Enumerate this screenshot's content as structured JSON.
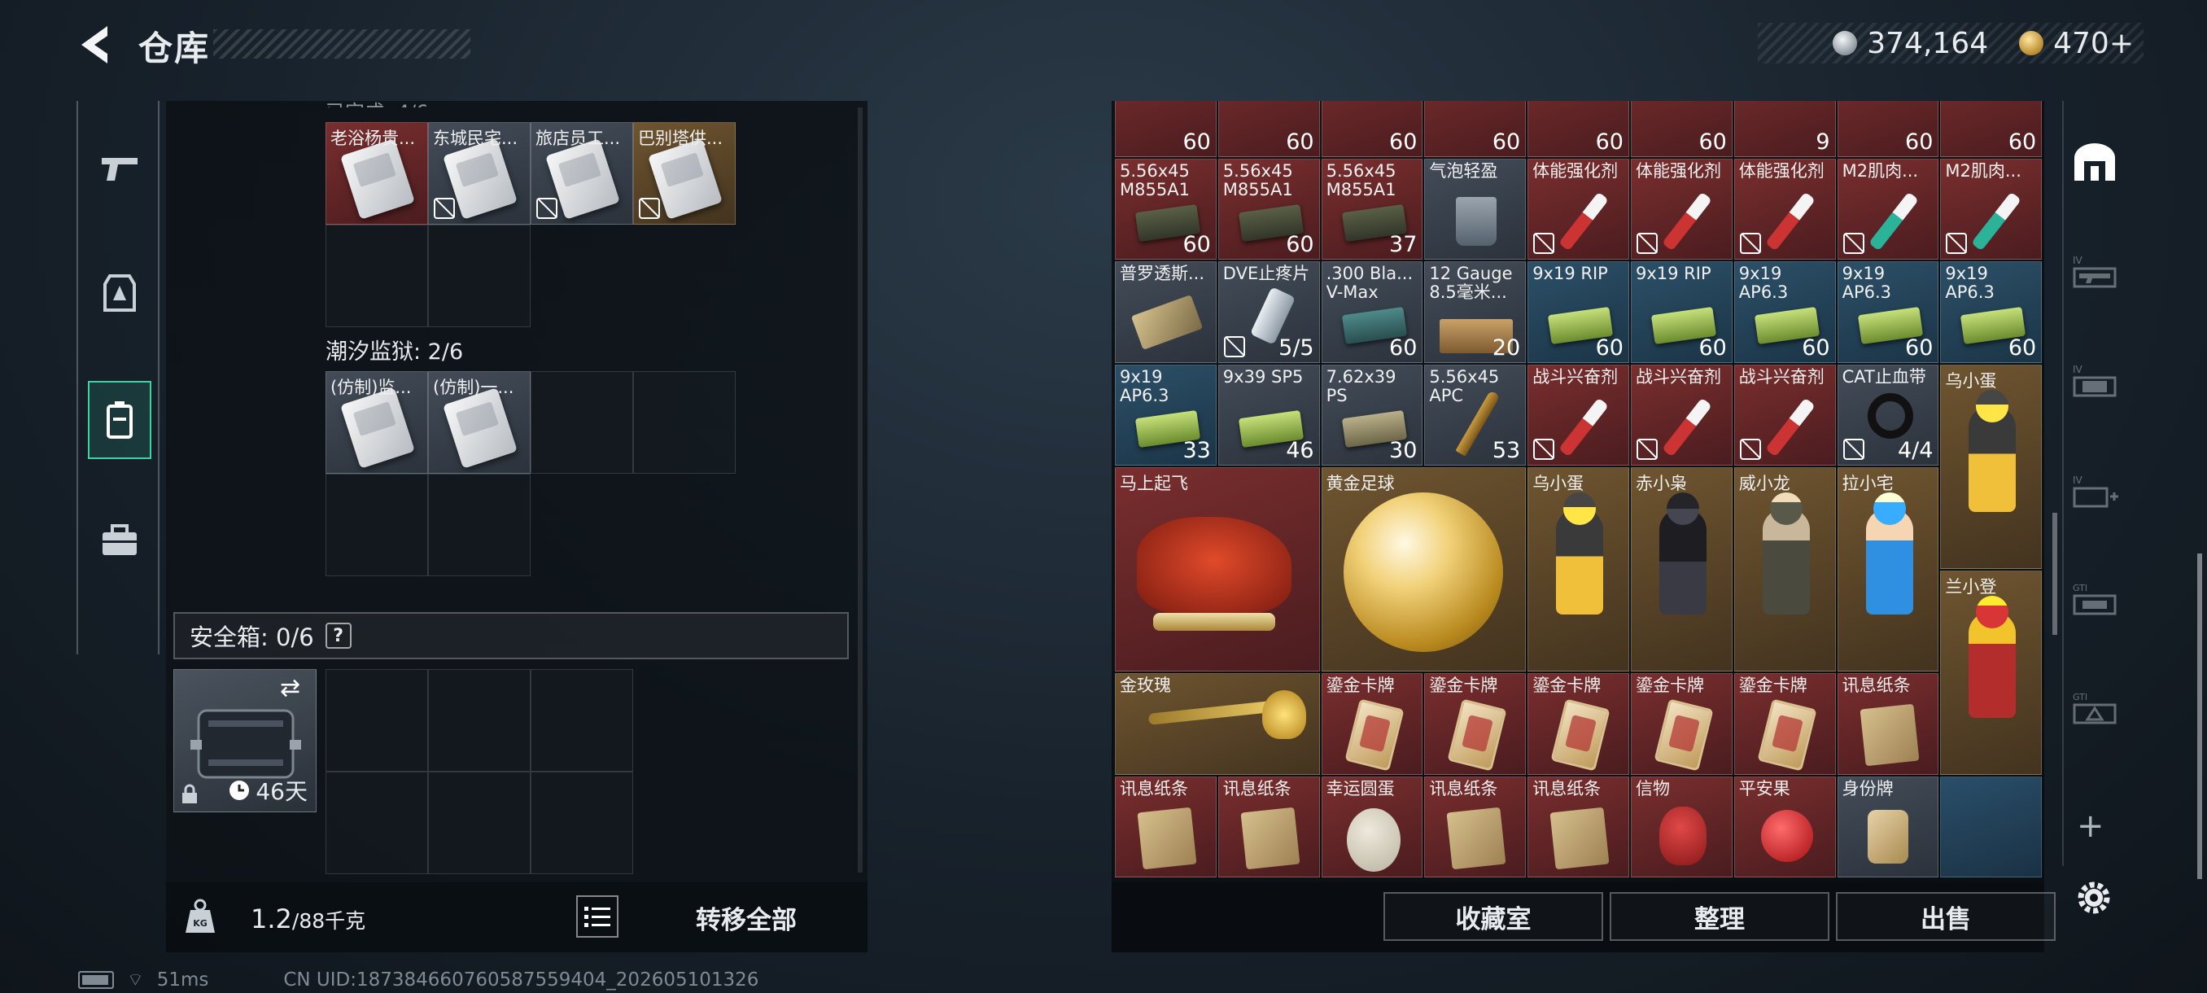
{
  "header": {
    "title": "仓库",
    "currency_silver": "374,164",
    "currency_gold": "470+"
  },
  "left_sections": {
    "section1_items": [
      {
        "label": "老浴杨贵...",
        "bg": "red",
        "noshare": false
      },
      {
        "label": "东城民宅...",
        "bg": "gray",
        "noshare": true
      },
      {
        "label": "旅店员工...",
        "bg": "gray",
        "noshare": true
      },
      {
        "label": "巴别塔供...",
        "bg": "gold",
        "noshare": true
      }
    ],
    "section2_label": "潮汐监狱: 2/6",
    "section2_items": [
      {
        "label": "(仿制)监...",
        "bg": "gray"
      },
      {
        "label": "(仿制)一...",
        "bg": "gray"
      }
    ],
    "safebox_label": "安全箱: 0/6",
    "safebox_help": "?",
    "safebox_days": "46天",
    "weight_value": "1.2",
    "weight_max": "/88千克",
    "transfer_label": "转移全部"
  },
  "status": {
    "ping": "51ms",
    "uid": "CN UID:18738466076058755940​4_202605101326"
  },
  "grid": {
    "row0": [
      "60",
      "60",
      "60",
      "60",
      "60",
      "60",
      "9",
      "60",
      "60"
    ],
    "items": [
      {
        "label": "5.56x45 M855A1",
        "qty": "60",
        "bg": "red",
        "art": "ammo",
        "col": 0,
        "row": 1
      },
      {
        "label": "5.56x45 M855A1",
        "qty": "60",
        "bg": "red",
        "art": "ammo",
        "col": 1,
        "row": 1
      },
      {
        "label": "5.56x45 M855A1",
        "qty": "37",
        "bg": "red",
        "art": "ammo",
        "col": 2,
        "row": 1
      },
      {
        "label": "气泡轻盈",
        "qty": "",
        "bg": "gray",
        "art": "glass",
        "col": 3,
        "row": 1
      },
      {
        "label": "体能强化剂",
        "qty": "",
        "bg": "red",
        "art": "syringe-red",
        "col": 4,
        "row": 1,
        "noshare": true
      },
      {
        "label": "体能强化剂",
        "qty": "",
        "bg": "red",
        "art": "syringe-red",
        "col": 5,
        "row": 1,
        "noshare": true
      },
      {
        "label": "体能强化剂",
        "qty": "",
        "bg": "red",
        "art": "syringe-red",
        "col": 6,
        "row": 1,
        "noshare": true
      },
      {
        "label": "M2肌肉...",
        "qty": "",
        "bg": "red",
        "art": "syringe-teal",
        "col": 7,
        "row": 1,
        "noshare": true
      },
      {
        "label": "M2肌肉...",
        "qty": "",
        "bg": "red",
        "art": "syringe-teal",
        "col": 8,
        "row": 1,
        "noshare": true
      },
      {
        "label": "普罗透斯...",
        "qty": "",
        "bg": "gray",
        "art": "chip",
        "col": 0,
        "row": 2
      },
      {
        "label": "DVE止疼片",
        "qty": "5/5",
        "bg": "gray",
        "art": "pill",
        "col": 1,
        "row": 2,
        "noshare": true
      },
      {
        "label": ".300 Bla... V-Max",
        "qty": "60",
        "bg": "gray",
        "art": "ammo-teal",
        "col": 2,
        "row": 2
      },
      {
        "label": "12 Gauge 8.5毫米...",
        "qty": "20",
        "bg": "gray",
        "art": "case",
        "col": 3,
        "row": 2
      },
      {
        "label": "9x19 RIP",
        "qty": "60",
        "bg": "blue",
        "art": "ammo-green",
        "col": 4,
        "row": 2
      },
      {
        "label": "9x19 RIP",
        "qty": "60",
        "bg": "blue",
        "art": "ammo-green",
        "col": 5,
        "row": 2
      },
      {
        "label": "9x19 AP6.3",
        "qty": "60",
        "bg": "blue",
        "art": "ammo-green",
        "col": 6,
        "row": 2
      },
      {
        "label": "9x19 AP6.3",
        "qty": "60",
        "bg": "blue",
        "art": "ammo-green",
        "col": 7,
        "row": 2
      },
      {
        "label": "9x19 AP6.3",
        "qty": "60",
        "bg": "blue",
        "art": "ammo-green",
        "col": 8,
        "row": 2
      },
      {
        "label": "9x19 AP6.3",
        "qty": "33",
        "bg": "blue",
        "art": "ammo-green",
        "col": 0,
        "row": 3
      },
      {
        "label": "9x39 SP5",
        "qty": "46",
        "bg": "gray",
        "art": "ammo-green",
        "col": 1,
        "row": 3
      },
      {
        "label": "7.62x39 PS",
        "qty": "30",
        "bg": "gray",
        "art": "ammo-tan",
        "col": 2,
        "row": 3
      },
      {
        "label": "5.56x45 APC",
        "qty": "53",
        "bg": "gray",
        "art": "bullet",
        "col": 3,
        "row": 3
      },
      {
        "label": "战斗兴奋剂",
        "qty": "",
        "bg": "red",
        "art": "syringe-red",
        "col": 4,
        "row": 3,
        "noshare": true
      },
      {
        "label": "战斗兴奋剂",
        "qty": "",
        "bg": "red",
        "art": "syringe-red",
        "col": 5,
        "row": 3,
        "noshare": true
      },
      {
        "label": "战斗兴奋剂",
        "qty": "",
        "bg": "red",
        "art": "syringe-red",
        "col": 6,
        "row": 3,
        "noshare": true
      },
      {
        "label": "CAT止血带",
        "qty": "4/4",
        "bg": "gray",
        "art": "tourniquet",
        "col": 7,
        "row": 3,
        "noshare": true
      },
      {
        "label": "金玫瑰",
        "qty": "",
        "bg": "gold",
        "art": "rose",
        "col": 0,
        "row": 6,
        "w": 2
      },
      {
        "label": "鎏金卡牌",
        "qty": "",
        "bg": "red",
        "art": "deck",
        "col": 2,
        "row": 6
      },
      {
        "label": "鎏金卡牌",
        "qty": "",
        "bg": "red",
        "art": "deck",
        "col": 3,
        "row": 6
      },
      {
        "label": "鎏金卡牌",
        "qty": "",
        "bg": "red",
        "art": "deck",
        "col": 4,
        "row": 6
      },
      {
        "label": "鎏金卡牌",
        "qty": "",
        "bg": "red",
        "art": "deck",
        "col": 5,
        "row": 6
      },
      {
        "label": "鎏金卡牌",
        "qty": "",
        "bg": "red",
        "art": "deck",
        "col": 6,
        "row": 6
      },
      {
        "label": "讯息纸条",
        "qty": "",
        "bg": "red",
        "art": "paper",
        "col": 7,
        "row": 6
      },
      {
        "label": "讯息纸条",
        "qty": "",
        "bg": "red",
        "art": "paper",
        "col": 0,
        "row": 7
      },
      {
        "label": "讯息纸条",
        "qty": "",
        "bg": "red",
        "art": "paper",
        "col": 1,
        "row": 7
      },
      {
        "label": "幸运圆蛋",
        "qty": "",
        "bg": "red",
        "art": "egg",
        "col": 2,
        "row": 7
      },
      {
        "label": "讯息纸条",
        "qty": "",
        "bg": "red",
        "art": "paper",
        "col": 3,
        "row": 7
      },
      {
        "label": "讯息纸条",
        "qty": "",
        "bg": "red",
        "art": "paper",
        "col": 4,
        "row": 7
      },
      {
        "label": "信物",
        "qty": "",
        "bg": "red",
        "art": "skull",
        "col": 5,
        "row": 7
      },
      {
        "label": "平安果",
        "qty": "",
        "bg": "red",
        "art": "apple",
        "col": 6,
        "row": 7
      },
      {
        "label": "身份牌",
        "qty": "",
        "bg": "gray",
        "art": "tag",
        "col": 7,
        "row": 7
      }
    ],
    "big_items": [
      {
        "label": "马上起飞",
        "bg": "red",
        "art": "horse",
        "col": 0,
        "row": 4,
        "w": 2,
        "h": 2
      },
      {
        "label": "黄金足球",
        "bg": "gold",
        "art": "ball",
        "col": 2,
        "row": 4,
        "w": 2,
        "h": 2
      },
      {
        "label": "乌小蛋",
        "bg": "gold",
        "art": "fig-egg",
        "col": 4,
        "row": 4,
        "w": 1,
        "h": 2
      },
      {
        "label": "赤小枭",
        "bg": "gold",
        "art": "fig-red",
        "col": 5,
        "row": 4,
        "w": 1,
        "h": 2
      },
      {
        "label": "威小龙",
        "bg": "gold",
        "art": "fig-soldier",
        "col": 6,
        "row": 4,
        "w": 1,
        "h": 2
      },
      {
        "label": "拉小宅",
        "bg": "gold",
        "art": "fig-blue",
        "col": 7,
        "row": 4,
        "w": 1,
        "h": 2
      },
      {
        "label": "乌小蛋",
        "bg": "gold",
        "art": "fig-egg",
        "col": 8,
        "row": 3,
        "w": 1,
        "h": 2
      },
      {
        "label": "兰小登",
        "bg": "gold",
        "art": "fig-mexican",
        "col": 8,
        "row": 5,
        "w": 1,
        "h": 2
      }
    ]
  },
  "right_bottom": {
    "collection": "收藏室",
    "sort": "整理",
    "sell": "出售"
  }
}
